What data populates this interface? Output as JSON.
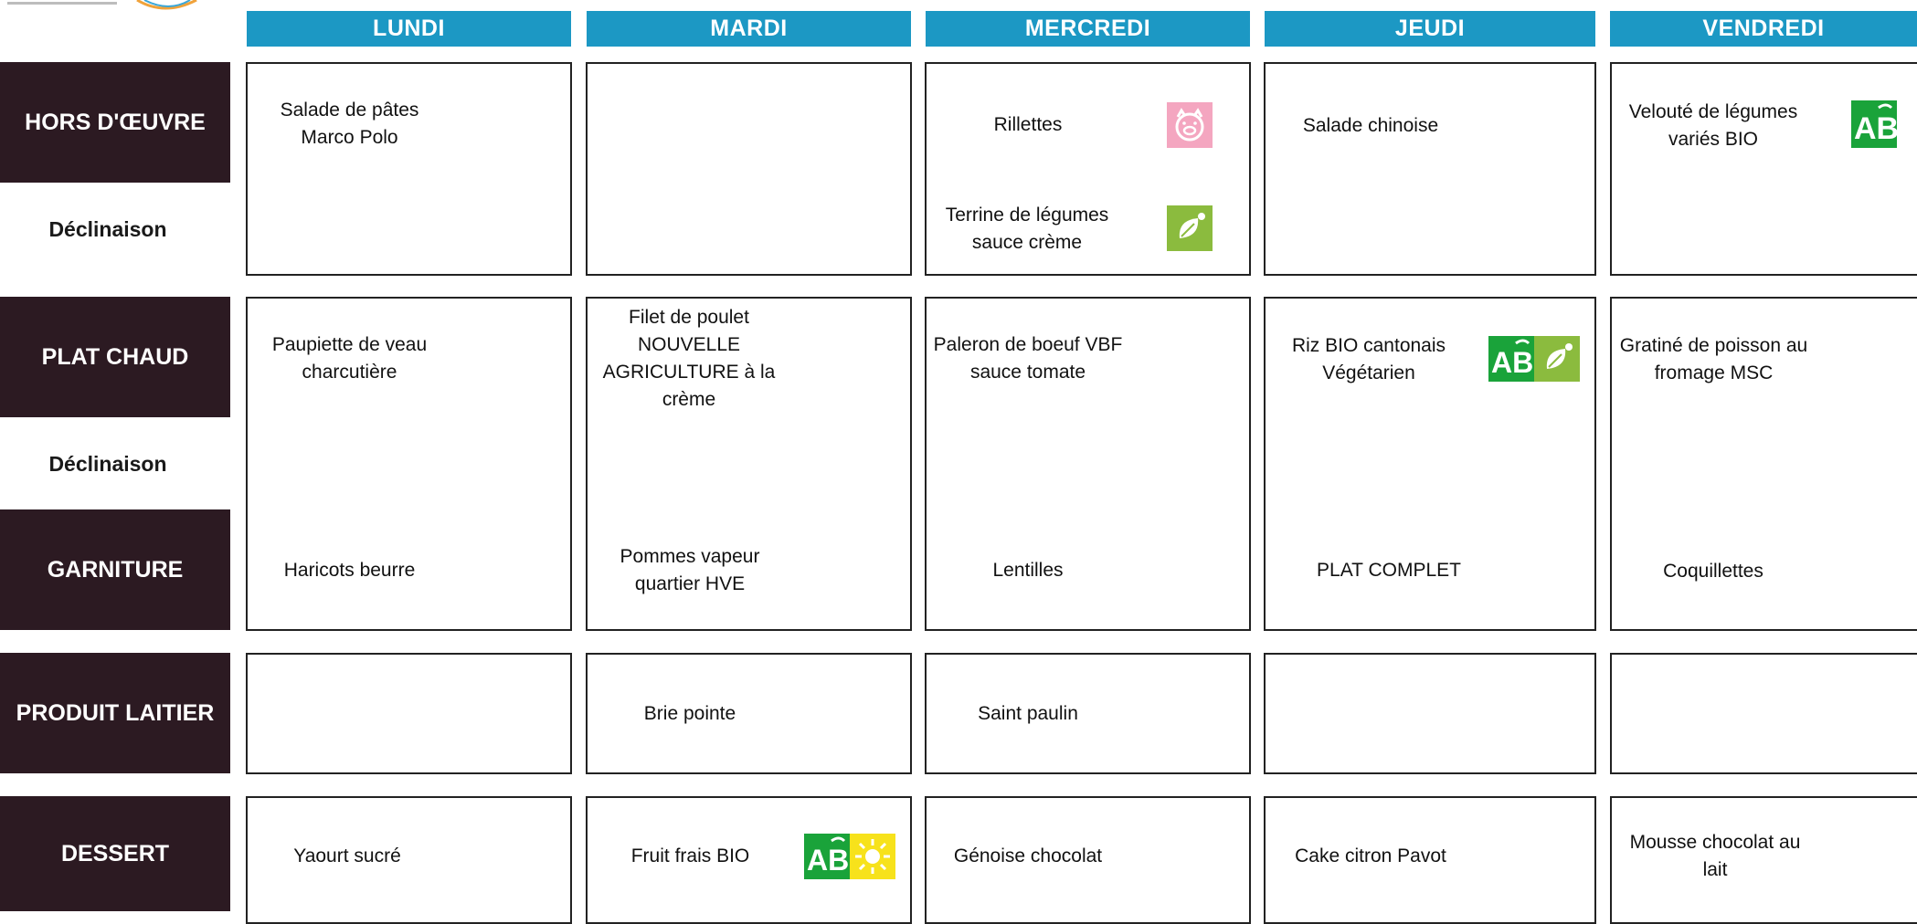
{
  "days": [
    "LUNDI",
    "MARDI",
    "MERCREDI",
    "JEUDI",
    "VENDREDI"
  ],
  "row_labels": {
    "hors_doeuvre": "HORS D'ŒUVRE",
    "declinaison": "Déclinaison",
    "plat_chaud": "PLAT CHAUD",
    "garniture": "GARNITURE",
    "produit_laitier": "PRODUIT LAITIER",
    "dessert": "DESSERT"
  },
  "menu": {
    "hors_doeuvre": {
      "lundi": [
        "Salade de pâtes",
        "Marco Polo"
      ],
      "mercredi": "Rillettes",
      "jeudi": "Salade chinoise",
      "vendredi": [
        "Velouté de légumes",
        "variés BIO"
      ]
    },
    "hors_doeuvre_declinaison": {
      "mercredi": [
        "Terrine de légumes",
        "sauce crème"
      ]
    },
    "plat_chaud": {
      "lundi": [
        "Paupiette de veau",
        "charcutière"
      ],
      "mardi": [
        "Filet de poulet",
        "NOUVELLE",
        "AGRICULTURE à la",
        "crème"
      ],
      "mercredi": [
        "Paleron de boeuf VBF",
        "sauce tomate"
      ],
      "jeudi": [
        "Riz BIO cantonais",
        "Végétarien"
      ],
      "vendredi": [
        "Gratiné de poisson au",
        "fromage MSC"
      ]
    },
    "garniture": {
      "lundi": "Haricots beurre",
      "mardi": [
        "Pommes vapeur",
        "quartier HVE"
      ],
      "mercredi": "Lentilles",
      "jeudi": "PLAT COMPLET",
      "vendredi": "Coquillettes"
    },
    "produit_laitier": {
      "mardi": "Brie pointe",
      "mercredi": "Saint paulin"
    },
    "dessert": {
      "lundi": "Yaourt sucré",
      "mardi": "Fruit frais BIO",
      "mercredi": "Génoise chocolat",
      "jeudi": "Cake citron Pavot",
      "vendredi": [
        "Mousse chocolat au",
        "lait"
      ]
    }
  },
  "badges": {
    "ab_label": "AB",
    "pork_icon": "pig-icon",
    "vegetarian_icon": "leaf-icon",
    "seasonal_icon": "sun-icon"
  },
  "colors": {
    "header_blue": "#1c98c4",
    "label_dark": "#2c1a22",
    "ab_green": "#1aa33a",
    "veg_green": "#8bbb3e",
    "pork_pink": "#f4a6c0",
    "sun_yellow": "#f7e21b"
  }
}
